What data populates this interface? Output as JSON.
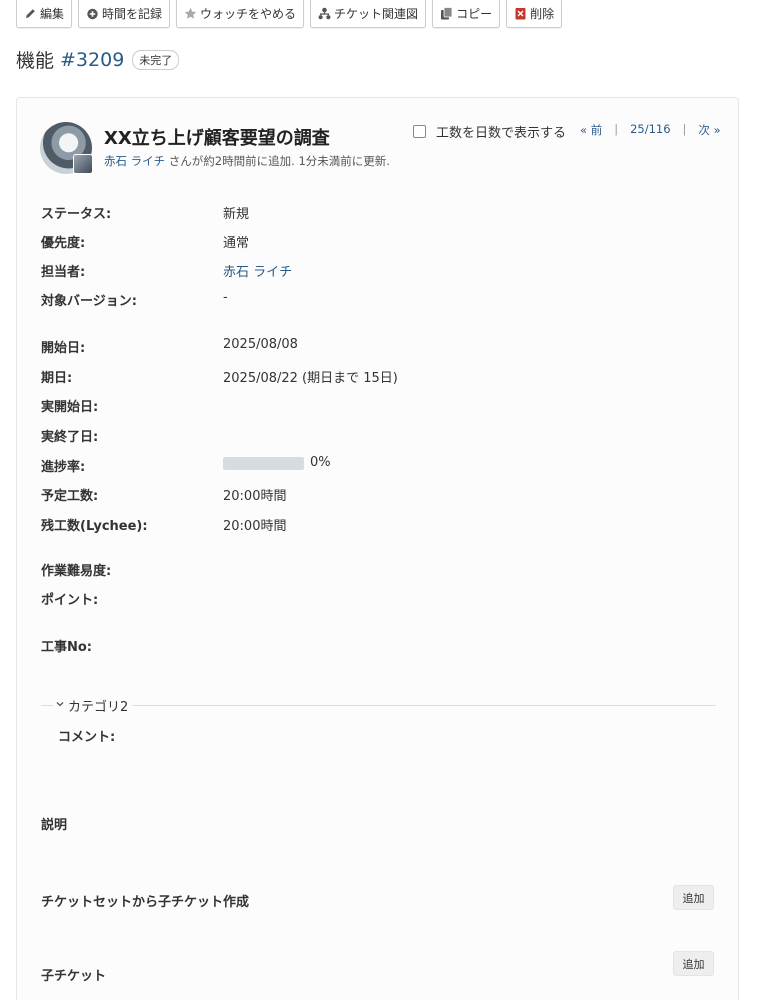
{
  "toolbar": {
    "edit": "編集",
    "log_time": "時間を記録",
    "unwatch": "ウォッチをやめる",
    "relation_graph": "チケット関連図",
    "copy": "コピー",
    "delete": "削除"
  },
  "header": {
    "tracker": "機能",
    "number": "#3209",
    "status_badge": "未完了"
  },
  "issue": {
    "subject": "XX立ち上げ顧客要望の調査",
    "author_name": "赤石 ライチ",
    "author_suffix": " さんが約2時間前に追加. 1分未満前に更新.",
    "days_toggle_label": "工数を日数で表示する",
    "pager": {
      "prev": "« 前",
      "position": "25/116",
      "next": "次 »"
    }
  },
  "attributes": {
    "status_label": "ステータス:",
    "status_value": "新規",
    "priority_label": "優先度:",
    "priority_value": "通常",
    "assignee_label": "担当者:",
    "assignee_value": "赤石 ライチ",
    "version_label": "対象バージョン:",
    "version_value": "-",
    "start_label": "開始日:",
    "start_value": "2025/08/08",
    "due_label": "期日:",
    "due_value": "2025/08/22 (期日まで 15日)",
    "actual_start_label": "実開始日:",
    "actual_end_label": "実終了日:",
    "progress_label": "進捗率:",
    "progress_percent": 0,
    "progress_text": "0%",
    "estimated_label": "予定工数:",
    "estimated_value": "20:00時間",
    "remaining_label": "残工数(Lychee):",
    "remaining_value": "20:00時間",
    "difficulty_label": "作業難易度:",
    "points_label": "ポイント:",
    "construction_label": "工事No:"
  },
  "category": {
    "title": "カテゴリ2",
    "comment_label": "コメント:"
  },
  "sections": {
    "description": "説明",
    "create_from_set": "チケットセットから子チケット作成",
    "subtasks": "子チケット",
    "add_label": "追加"
  },
  "colors": {
    "link": "#2a5a8a",
    "progress_track": "#d7dcdf"
  }
}
